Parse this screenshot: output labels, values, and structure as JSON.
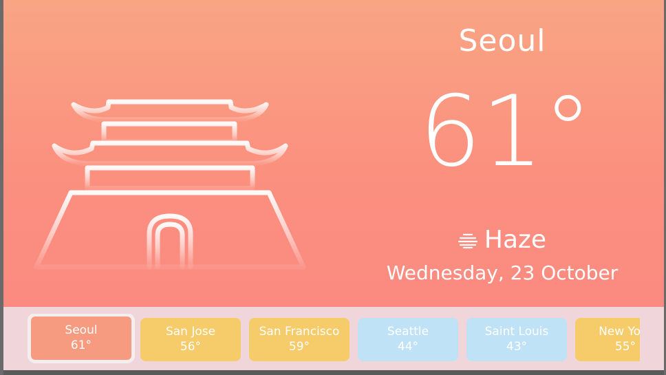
{
  "current": {
    "city": "Seoul",
    "temperature": "61°",
    "condition": "Haze",
    "condition_icon": "haze-icon",
    "date": "Wednesday, 23 October"
  },
  "cities": [
    {
      "name": "Seoul",
      "temp": "61°",
      "theme": "selected"
    },
    {
      "name": "San Jose",
      "temp": "56°",
      "theme": "warm"
    },
    {
      "name": "San Francisco",
      "temp": "59°",
      "theme": "warm"
    },
    {
      "name": "Seattle",
      "temp": "44°",
      "theme": "cool"
    },
    {
      "name": "Saint Louis",
      "temp": "43°",
      "theme": "cool"
    },
    {
      "name": "New York",
      "temp": "55°",
      "theme": "warm"
    }
  ],
  "colors": {
    "hero_top": "#f9a584",
    "hero_bottom": "#fb8a80",
    "warm_card": "#f6cb6a",
    "cool_card": "#bfe2f6",
    "selected_card": "#f69b80",
    "strip": "#f0d6da"
  }
}
